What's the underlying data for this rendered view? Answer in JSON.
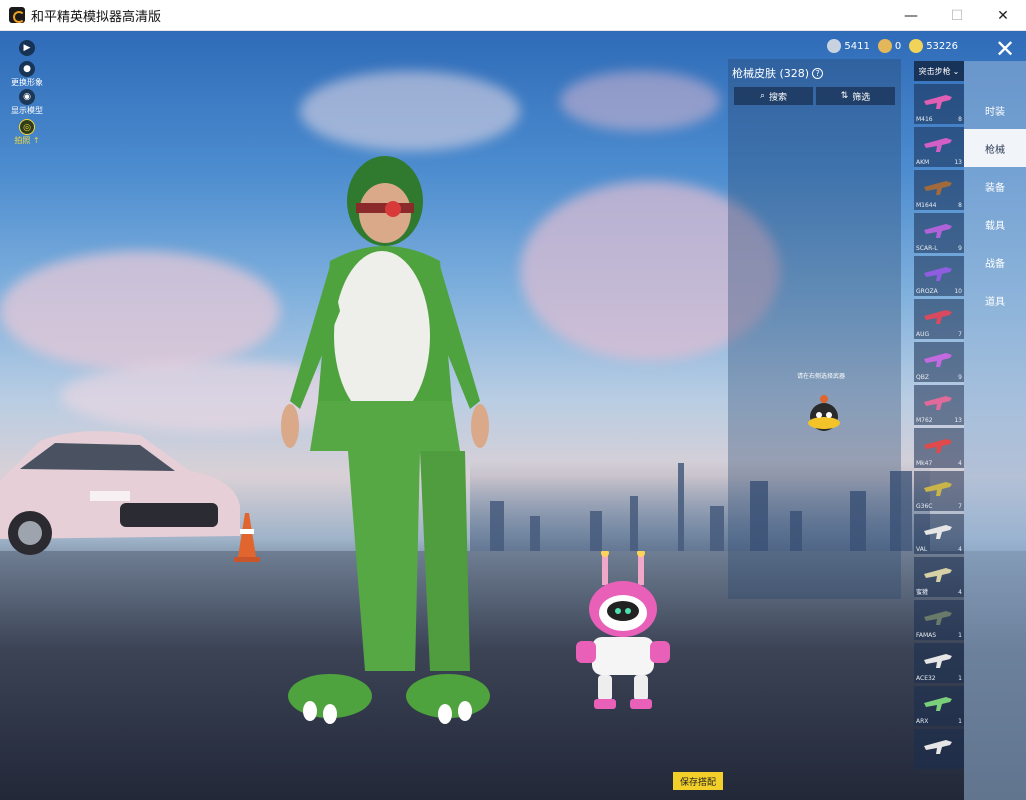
{
  "window": {
    "title": "和平精英模拟器高清版",
    "controls": [
      "—",
      "☐",
      "✕"
    ]
  },
  "left_toolbar": {
    "items": [
      {
        "label": "",
        "icon": "play-icon"
      },
      {
        "label": "更换形象",
        "icon": "avatar-icon"
      },
      {
        "label": "显示模型",
        "icon": "eye-icon"
      },
      {
        "label": "拍照",
        "icon": "camera-icon"
      }
    ]
  },
  "currencies": [
    {
      "icon": "silver-coin-icon",
      "value": "5411",
      "color": "#c9d3e0"
    },
    {
      "icon": "bronze-coin-icon",
      "value": "0",
      "color": "#e4b85a"
    },
    {
      "icon": "gold-coin-icon",
      "value": "53226",
      "color": "#f2d35a"
    }
  ],
  "skin_panel": {
    "title": "枪械皮肤 (328)",
    "search_label": "搜索",
    "filter_label": "筛选",
    "hint": "请在右侧选择武器"
  },
  "weapon_dropdown": "突击步枪",
  "weapons": [
    {
      "name": "M416",
      "count": "8",
      "color": "#e05fb5"
    },
    {
      "name": "AKM",
      "count": "13",
      "color": "#d45ec8"
    },
    {
      "name": "M1644",
      "count": "8",
      "color": "#a06a3c"
    },
    {
      "name": "SCAR-L",
      "count": "9",
      "color": "#b063d8"
    },
    {
      "name": "GROZA",
      "count": "10",
      "color": "#8f5de0"
    },
    {
      "name": "AUG",
      "count": "7",
      "color": "#d84a5f"
    },
    {
      "name": "QBZ",
      "count": "9",
      "color": "#c46ae0"
    },
    {
      "name": "M762",
      "count": "13",
      "color": "#e06a9a"
    },
    {
      "name": "Mk47",
      "count": "4",
      "color": "#e04a4a"
    },
    {
      "name": "G36C",
      "count": "7",
      "color": "#c9b44a"
    },
    {
      "name": "VAL",
      "count": "4",
      "color": "#e6e6e6"
    },
    {
      "name": "蜜獾",
      "count": "4",
      "color": "#d6d0a6"
    },
    {
      "name": "FAMAS",
      "count": "1",
      "color": "#6a7a6a"
    },
    {
      "name": "ACE32",
      "count": "1",
      "color": "#e6e6e6"
    },
    {
      "name": "ARX",
      "count": "1",
      "color": "#7ad07a"
    },
    {
      "name": "",
      "count": "",
      "color": "#e6e6e6"
    }
  ],
  "categories": [
    {
      "label": "时装",
      "active": false
    },
    {
      "label": "枪械",
      "active": true
    },
    {
      "label": "装备",
      "active": false
    },
    {
      "label": "载具",
      "active": false
    },
    {
      "label": "战备",
      "active": false
    },
    {
      "label": "道具",
      "active": false
    }
  ],
  "save_button": "保存搭配"
}
